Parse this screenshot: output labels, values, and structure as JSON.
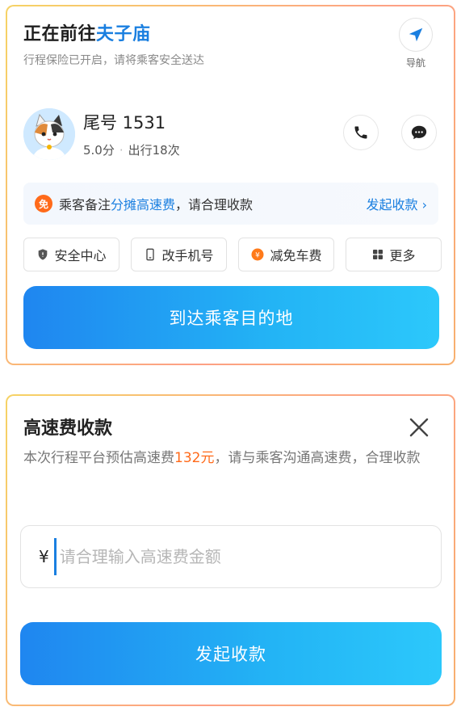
{
  "trip": {
    "title_prefix": "正在前往",
    "destination": "夫子庙",
    "subtitle": "行程保险已开启，请将乘客安全送达",
    "nav_label": "导航"
  },
  "passenger": {
    "name": "尾号 1531",
    "rating": "5.0分",
    "trips": "出行18次"
  },
  "note": {
    "icon": "免",
    "prefix": "乘客备注",
    "highlight": "分摊高速费",
    "suffix": "，请合理收款",
    "action": "发起收款 ›"
  },
  "actions": [
    {
      "label": "安全中心",
      "icon": "shield-icon"
    },
    {
      "label": "改手机号",
      "icon": "phone-device-icon"
    },
    {
      "label": "减免车费",
      "icon": "coin-icon"
    },
    {
      "label": "更多",
      "icon": "grid-icon"
    }
  ],
  "arrive_button": "到达乘客目的地",
  "toll_sheet": {
    "title": "高速费收款",
    "desc_prefix": "本次行程平台预估高速费",
    "estimate": "132元",
    "desc_suffix": "，请与乘客沟通高速费，合理收款",
    "currency": "¥",
    "input_placeholder": "请合理输入高速费金额",
    "input_value": "",
    "submit_label": "发起收款"
  },
  "colors": {
    "accent_blue": "#1a7fe0",
    "orange": "#ff6a1a",
    "button_gradient_start": "#1f86f0",
    "button_gradient_end": "#2cc8fb"
  }
}
